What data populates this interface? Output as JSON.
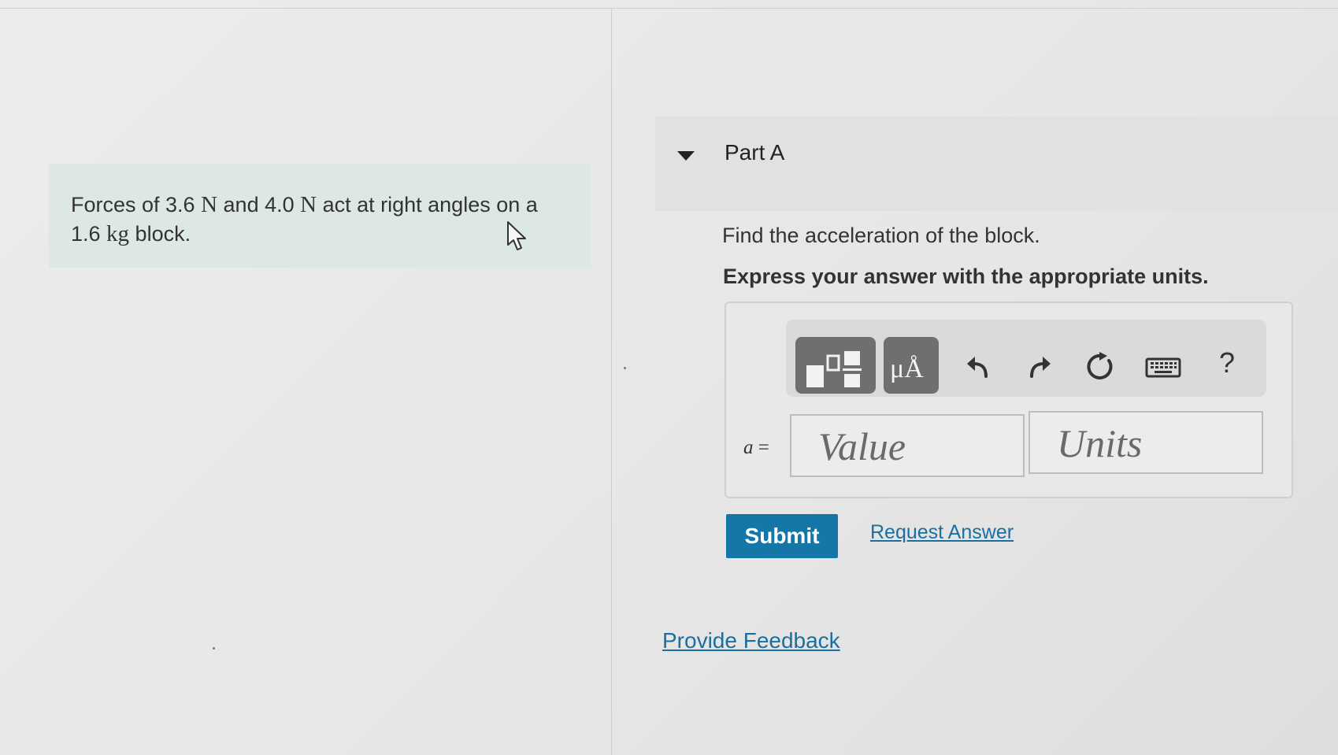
{
  "problem": {
    "line1_pre": "Forces of 3.6 ",
    "unit_n1": "N",
    "line1_mid": " and 4.0 ",
    "unit_n2": "N",
    "line1_post": " act at right angles on a",
    "line2_pre": "1.6 ",
    "unit_kg": "kg",
    "line2_post": " block."
  },
  "part": {
    "title": "Part A",
    "question": "Find the acceleration of the block.",
    "instruction": "Express your answer with the appropriate units."
  },
  "toolbar": {
    "icons": [
      "templates-icon",
      "units-icon",
      "undo-icon",
      "redo-icon",
      "reset-icon",
      "keyboard-icon",
      "help-icon"
    ],
    "units_glyph": "μÅ",
    "help_label": "?"
  },
  "answer": {
    "variable": "a",
    "equals": "=",
    "value_placeholder": "Value",
    "units_placeholder": "Units"
  },
  "actions": {
    "submit_label": "Submit",
    "request_answer_label": "Request Answer",
    "feedback_label": "Provide Feedback"
  }
}
